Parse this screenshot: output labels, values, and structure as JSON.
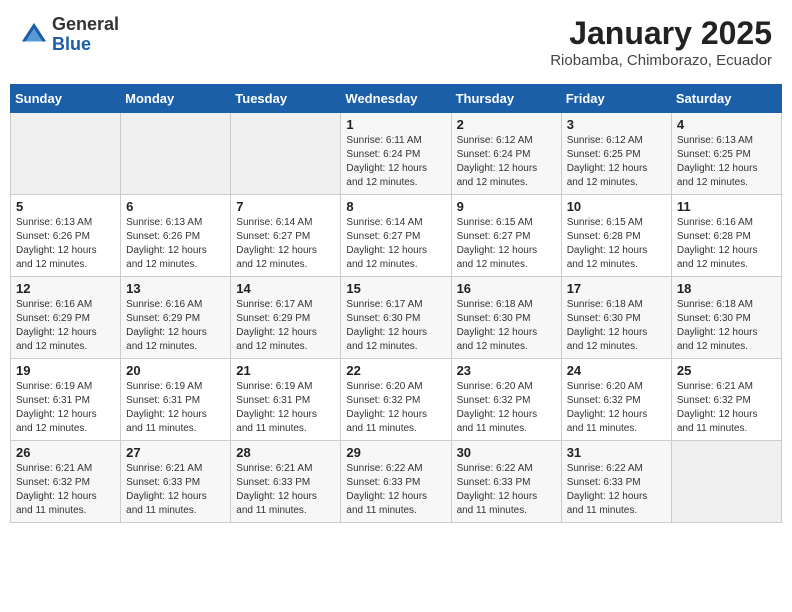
{
  "header": {
    "logo_line1": "General",
    "logo_line2": "Blue",
    "title": "January 2025",
    "subtitle": "Riobamba, Chimborazo, Ecuador"
  },
  "weekdays": [
    "Sunday",
    "Monday",
    "Tuesday",
    "Wednesday",
    "Thursday",
    "Friday",
    "Saturday"
  ],
  "weeks": [
    [
      {
        "day": "",
        "sunrise": "",
        "sunset": "",
        "daylight": ""
      },
      {
        "day": "",
        "sunrise": "",
        "sunset": "",
        "daylight": ""
      },
      {
        "day": "",
        "sunrise": "",
        "sunset": "",
        "daylight": ""
      },
      {
        "day": "1",
        "sunrise": "Sunrise: 6:11 AM",
        "sunset": "Sunset: 6:24 PM",
        "daylight": "Daylight: 12 hours and 12 minutes."
      },
      {
        "day": "2",
        "sunrise": "Sunrise: 6:12 AM",
        "sunset": "Sunset: 6:24 PM",
        "daylight": "Daylight: 12 hours and 12 minutes."
      },
      {
        "day": "3",
        "sunrise": "Sunrise: 6:12 AM",
        "sunset": "Sunset: 6:25 PM",
        "daylight": "Daylight: 12 hours and 12 minutes."
      },
      {
        "day": "4",
        "sunrise": "Sunrise: 6:13 AM",
        "sunset": "Sunset: 6:25 PM",
        "daylight": "Daylight: 12 hours and 12 minutes."
      }
    ],
    [
      {
        "day": "5",
        "sunrise": "Sunrise: 6:13 AM",
        "sunset": "Sunset: 6:26 PM",
        "daylight": "Daylight: 12 hours and 12 minutes."
      },
      {
        "day": "6",
        "sunrise": "Sunrise: 6:13 AM",
        "sunset": "Sunset: 6:26 PM",
        "daylight": "Daylight: 12 hours and 12 minutes."
      },
      {
        "day": "7",
        "sunrise": "Sunrise: 6:14 AM",
        "sunset": "Sunset: 6:27 PM",
        "daylight": "Daylight: 12 hours and 12 minutes."
      },
      {
        "day": "8",
        "sunrise": "Sunrise: 6:14 AM",
        "sunset": "Sunset: 6:27 PM",
        "daylight": "Daylight: 12 hours and 12 minutes."
      },
      {
        "day": "9",
        "sunrise": "Sunrise: 6:15 AM",
        "sunset": "Sunset: 6:27 PM",
        "daylight": "Daylight: 12 hours and 12 minutes."
      },
      {
        "day": "10",
        "sunrise": "Sunrise: 6:15 AM",
        "sunset": "Sunset: 6:28 PM",
        "daylight": "Daylight: 12 hours and 12 minutes."
      },
      {
        "day": "11",
        "sunrise": "Sunrise: 6:16 AM",
        "sunset": "Sunset: 6:28 PM",
        "daylight": "Daylight: 12 hours and 12 minutes."
      }
    ],
    [
      {
        "day": "12",
        "sunrise": "Sunrise: 6:16 AM",
        "sunset": "Sunset: 6:29 PM",
        "daylight": "Daylight: 12 hours and 12 minutes."
      },
      {
        "day": "13",
        "sunrise": "Sunrise: 6:16 AM",
        "sunset": "Sunset: 6:29 PM",
        "daylight": "Daylight: 12 hours and 12 minutes."
      },
      {
        "day": "14",
        "sunrise": "Sunrise: 6:17 AM",
        "sunset": "Sunset: 6:29 PM",
        "daylight": "Daylight: 12 hours and 12 minutes."
      },
      {
        "day": "15",
        "sunrise": "Sunrise: 6:17 AM",
        "sunset": "Sunset: 6:30 PM",
        "daylight": "Daylight: 12 hours and 12 minutes."
      },
      {
        "day": "16",
        "sunrise": "Sunrise: 6:18 AM",
        "sunset": "Sunset: 6:30 PM",
        "daylight": "Daylight: 12 hours and 12 minutes."
      },
      {
        "day": "17",
        "sunrise": "Sunrise: 6:18 AM",
        "sunset": "Sunset: 6:30 PM",
        "daylight": "Daylight: 12 hours and 12 minutes."
      },
      {
        "day": "18",
        "sunrise": "Sunrise: 6:18 AM",
        "sunset": "Sunset: 6:30 PM",
        "daylight": "Daylight: 12 hours and 12 minutes."
      }
    ],
    [
      {
        "day": "19",
        "sunrise": "Sunrise: 6:19 AM",
        "sunset": "Sunset: 6:31 PM",
        "daylight": "Daylight: 12 hours and 12 minutes."
      },
      {
        "day": "20",
        "sunrise": "Sunrise: 6:19 AM",
        "sunset": "Sunset: 6:31 PM",
        "daylight": "Daylight: 12 hours and 11 minutes."
      },
      {
        "day": "21",
        "sunrise": "Sunrise: 6:19 AM",
        "sunset": "Sunset: 6:31 PM",
        "daylight": "Daylight: 12 hours and 11 minutes."
      },
      {
        "day": "22",
        "sunrise": "Sunrise: 6:20 AM",
        "sunset": "Sunset: 6:32 PM",
        "daylight": "Daylight: 12 hours and 11 minutes."
      },
      {
        "day": "23",
        "sunrise": "Sunrise: 6:20 AM",
        "sunset": "Sunset: 6:32 PM",
        "daylight": "Daylight: 12 hours and 11 minutes."
      },
      {
        "day": "24",
        "sunrise": "Sunrise: 6:20 AM",
        "sunset": "Sunset: 6:32 PM",
        "daylight": "Daylight: 12 hours and 11 minutes."
      },
      {
        "day": "25",
        "sunrise": "Sunrise: 6:21 AM",
        "sunset": "Sunset: 6:32 PM",
        "daylight": "Daylight: 12 hours and 11 minutes."
      }
    ],
    [
      {
        "day": "26",
        "sunrise": "Sunrise: 6:21 AM",
        "sunset": "Sunset: 6:32 PM",
        "daylight": "Daylight: 12 hours and 11 minutes."
      },
      {
        "day": "27",
        "sunrise": "Sunrise: 6:21 AM",
        "sunset": "Sunset: 6:33 PM",
        "daylight": "Daylight: 12 hours and 11 minutes."
      },
      {
        "day": "28",
        "sunrise": "Sunrise: 6:21 AM",
        "sunset": "Sunset: 6:33 PM",
        "daylight": "Daylight: 12 hours and 11 minutes."
      },
      {
        "day": "29",
        "sunrise": "Sunrise: 6:22 AM",
        "sunset": "Sunset: 6:33 PM",
        "daylight": "Daylight: 12 hours and 11 minutes."
      },
      {
        "day": "30",
        "sunrise": "Sunrise: 6:22 AM",
        "sunset": "Sunset: 6:33 PM",
        "daylight": "Daylight: 12 hours and 11 minutes."
      },
      {
        "day": "31",
        "sunrise": "Sunrise: 6:22 AM",
        "sunset": "Sunset: 6:33 PM",
        "daylight": "Daylight: 12 hours and 11 minutes."
      },
      {
        "day": "",
        "sunrise": "",
        "sunset": "",
        "daylight": ""
      }
    ]
  ]
}
